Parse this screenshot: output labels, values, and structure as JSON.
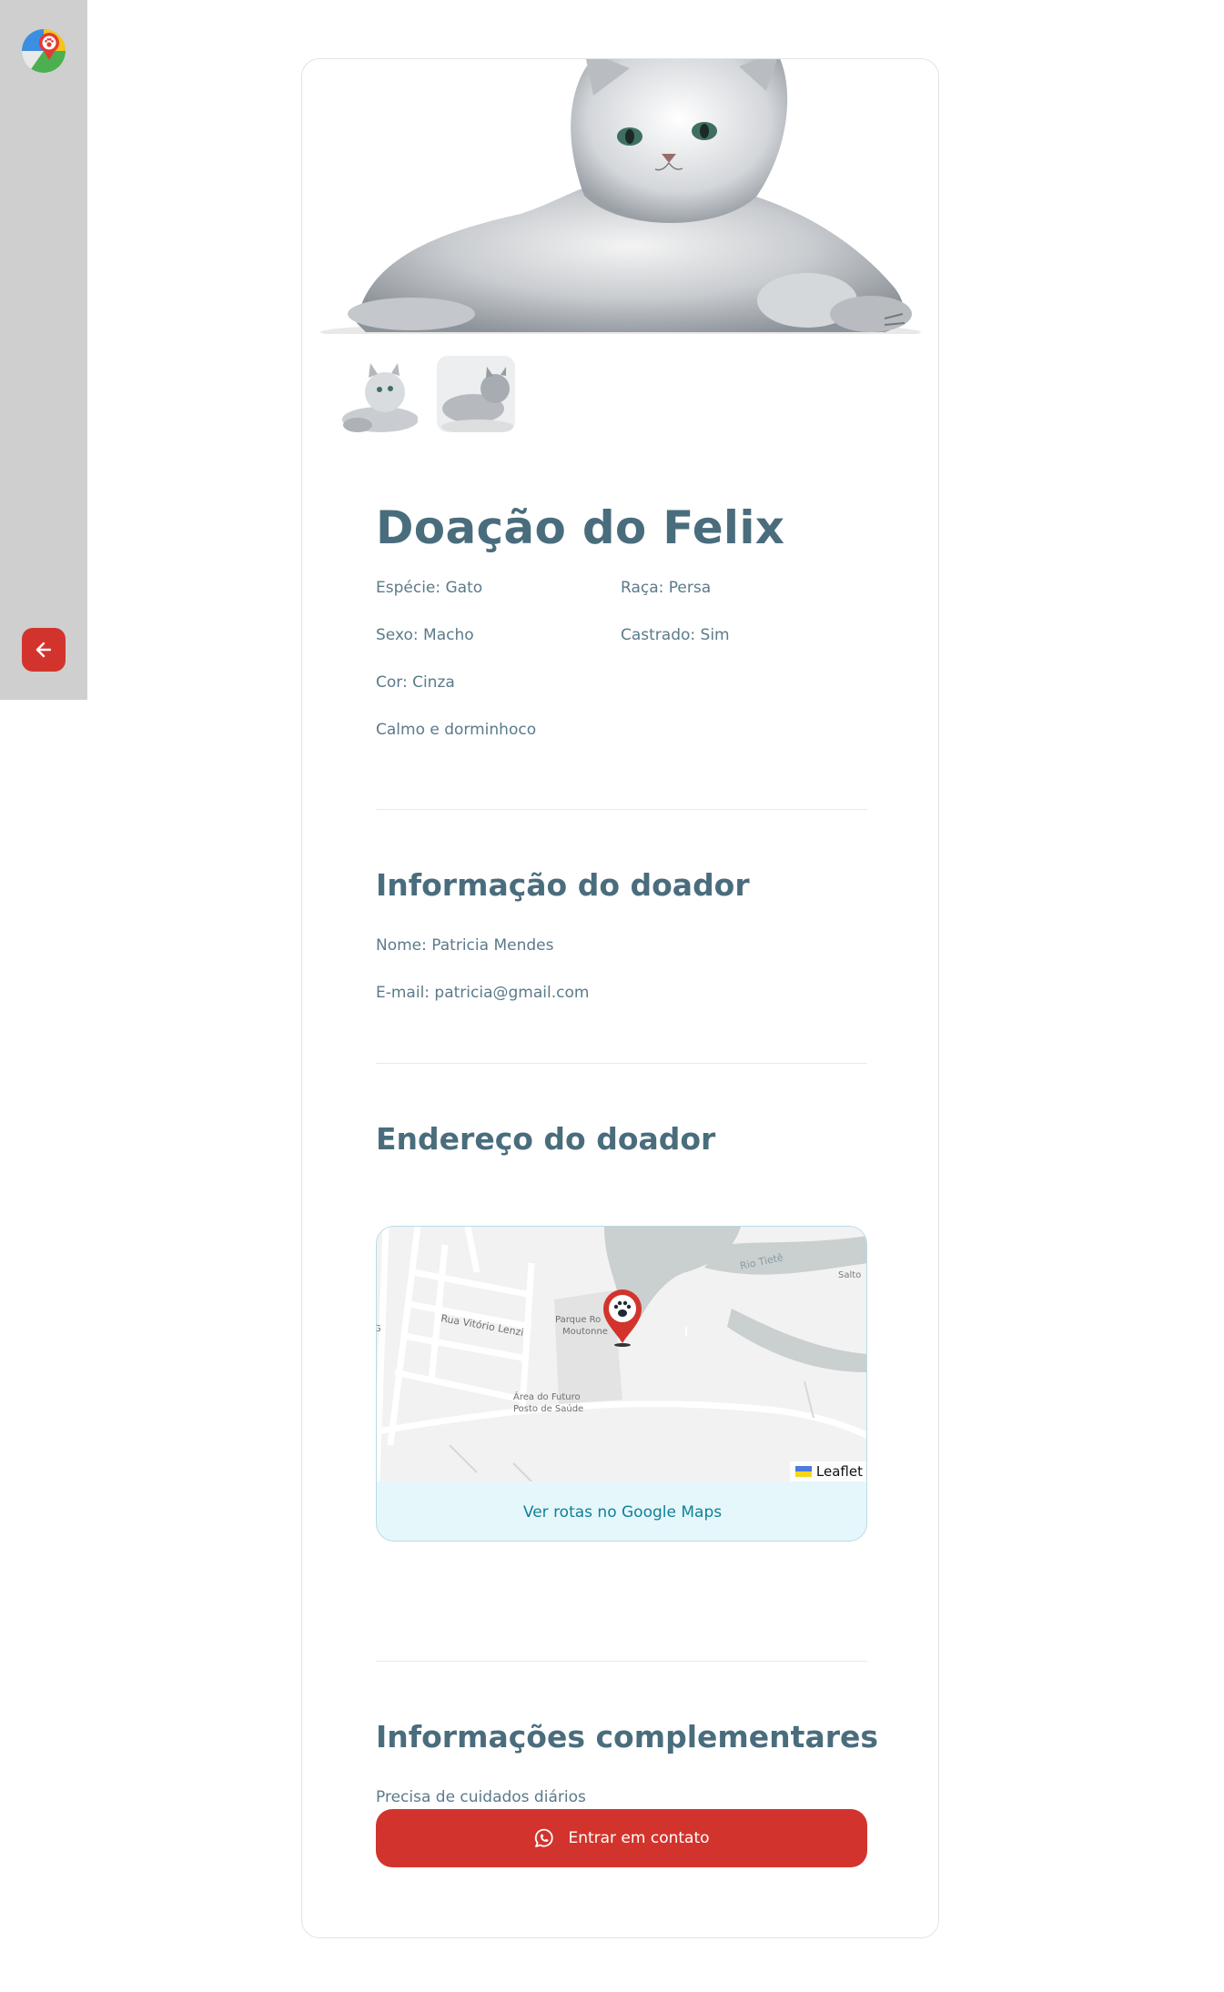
{
  "sidebar": {
    "logo_icon": "paw-map-pin-logo",
    "back_icon": "arrow-left-icon"
  },
  "pet": {
    "title": "Doação do Felix",
    "details": {
      "especie": "Espécie: Gato",
      "raca": "Raça: Persa",
      "sexo": "Sexo: Macho",
      "castrado": "Castrado: Sim",
      "cor": "Cor: Cinza",
      "descricao": "Calmo e dorminhoco"
    }
  },
  "donor": {
    "heading": "Informação do doador",
    "name": "Nome: Patricia Mendes",
    "email": "E-mail: patricia@gmail.com"
  },
  "address": {
    "heading": "Endereço do doador",
    "map_labels": {
      "rio": "Rio Tietê",
      "salto": "Salto",
      "rua": "Rua Vitório Lenzi",
      "parque_1": "Parque Ro",
      "parque_2": "Moutonne",
      "area_1": "Área do Futuro",
      "area_2": "Posto de Saúde",
      "edge": "G"
    },
    "attribution": "Leaflet",
    "directions_link": "Ver rotas no Google Maps",
    "marker_icon": "paw-marker-icon"
  },
  "complementary": {
    "heading": "Informações complementares",
    "text": "Precisa de cuidados diários"
  },
  "contact": {
    "label": "Entrar em contato",
    "icon": "whatsapp-icon"
  },
  "colors": {
    "accent_red": "#d2342d",
    "heading": "#4a6d7d",
    "link": "#0c8299",
    "sidebar": "#cfcfcf"
  }
}
